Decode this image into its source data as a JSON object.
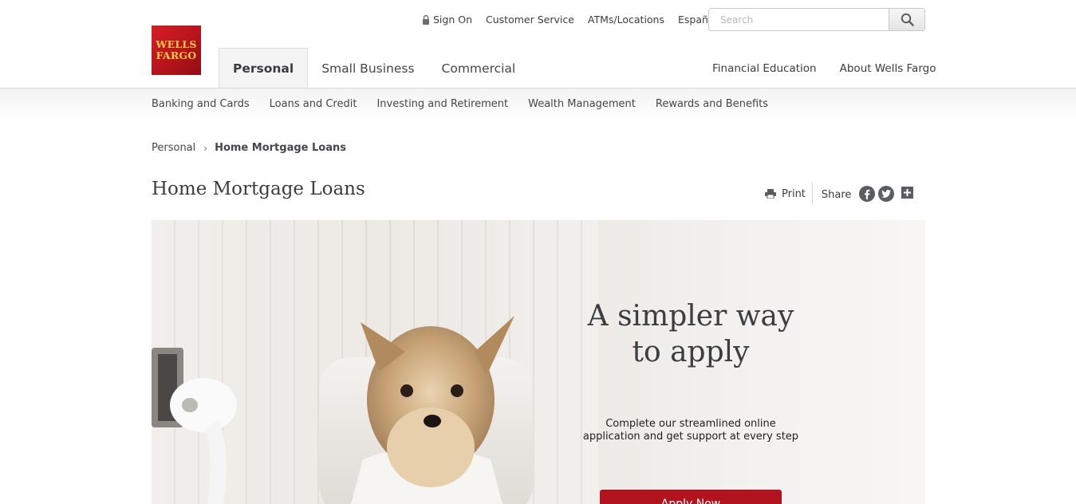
{
  "brand": {
    "line1": "WELLS",
    "line2": "FARGO",
    "color": "#d71e28",
    "text_color": "#ffcd41"
  },
  "utility_nav": {
    "sign_on": "Sign On",
    "customer_service": "Customer Service",
    "atms": "ATMs/Locations",
    "espanol": "Español"
  },
  "search": {
    "placeholder": "Search",
    "icon": "search-icon"
  },
  "main_tabs": [
    {
      "label": "Personal",
      "active": true
    },
    {
      "label": "Small Business",
      "active": false
    },
    {
      "label": "Commercial",
      "active": false
    }
  ],
  "right_links": [
    "Financial Education",
    "About Wells Fargo"
  ],
  "sub_nav": [
    "Banking and Cards",
    "Loans and Credit",
    "Investing and Retirement",
    "Wealth Management",
    "Rewards and Benefits"
  ],
  "breadcrumb": {
    "parent": "Personal",
    "current": "Home Mortgage Loans"
  },
  "page_title": "Home Mortgage Loans",
  "tools": {
    "print": "Print",
    "share": "Share",
    "share_icons": [
      "facebook-icon",
      "twitter-icon",
      "plus-icon"
    ]
  },
  "hero": {
    "headline_line1": "A simpler way",
    "headline_line2": "to apply",
    "subtext_line1": "Complete our streamlined online",
    "subtext_line2": "application and get support at every step",
    "button": "Apply Now",
    "button_color": "#b1141e"
  }
}
